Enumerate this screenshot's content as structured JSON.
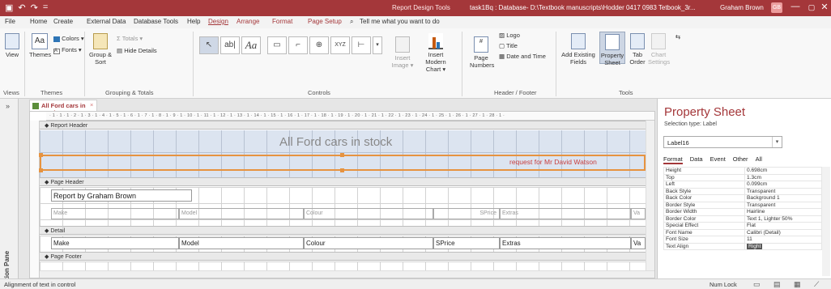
{
  "titlebar": {
    "context": "Report Design Tools",
    "document": "task1Bq : Database- D:\\Textbook manuscripts\\Hodder 0417 0983 Tetbook_3r...",
    "user": "Graham Brown",
    "avatar": "GB",
    "controls": [
      "—",
      "▢",
      "✕"
    ],
    "qa_icons": [
      "save-icon",
      "undo-icon",
      "redo-icon",
      "customize-icon"
    ]
  },
  "tabs": [
    "File",
    "Home",
    "Create",
    "External Data",
    "Database Tools",
    "Help",
    "Design",
    "Arrange",
    "Format",
    "Page Setup"
  ],
  "tell_me": "Tell me what you want to do",
  "ribbon": {
    "views": {
      "view": "View",
      "group": "Views"
    },
    "themes": {
      "themes": "Themes",
      "colors": "Colors ▾",
      "fonts": "Fonts ▾",
      "group": "Themes"
    },
    "grouping": {
      "group_sort": "Group & Sort",
      "totals": "Totals ▾",
      "hide_details": "Hide Details",
      "group": "Grouping & Totals"
    },
    "controls": {
      "group": "Controls",
      "insert_image": "Insert Image ▾",
      "insert_modern_chart": "Insert Modern Chart ▾",
      "label_glyph": "Aa",
      "textbox_glyph": "ab|",
      "xyz": "XYZ"
    },
    "header_footer": {
      "page_numbers": "Page Numbers",
      "logo": "Logo",
      "title": "Title",
      "date_time": "Date and Time",
      "group": "Header / Footer"
    },
    "tools": {
      "add_existing_fields": "Add Existing Fields",
      "property_sheet": "Property Sheet",
      "tab_order": "Tab Order",
      "chart_settings": "Chart Settings",
      "group": "Tools"
    }
  },
  "navpane": {
    "label": "Navigation Pane",
    "chevron": "»"
  },
  "doc_tab": {
    "label": "All Ford cars in stock",
    "close": "×"
  },
  "designer": {
    "ruler": "· 1 · 1 · 1 · 2 · 1 · 3 · 1 · 4 · 1 · 5 · 1 · 6 · 1 · 7 · 1 · 8 · 1 · 9 · 1 · 10 · 1 · 11 · 1 · 12 · 1 · 13 · 1 · 14 · 1 · 15 · 1 · 16 · 1 · 17 · 1 · 18 · 1 · 19 · 1 · 20 · 1 · 21 · 1 · 22 · 1 · 23 · 1 · 24 · 1 · 25 · 1 · 26 · 1 · 27 · 1 · 28 · 1 ·",
    "sections": {
      "report_header": "Report Header",
      "page_header": "Page Header",
      "detail": "Detail",
      "page_footer": "Page Footer"
    },
    "report_title": "All Ford cars in stock",
    "request_label": "request for Mr David Watson",
    "report_by": "Report by Graham Brown",
    "header_labels": [
      "Make",
      "Model",
      "Colour",
      "SPrice",
      "Extras",
      "Va"
    ],
    "detail_fields": [
      "Make",
      "Model",
      "Colour",
      "SPrice",
      "Extras",
      "Va"
    ]
  },
  "property_sheet": {
    "title": "Property Sheet",
    "selection_type": "Selection type: Label",
    "selected_object": "Label16",
    "tabs": [
      "Format",
      "Data",
      "Event",
      "Other",
      "All"
    ],
    "active_tab": "Format",
    "rows": [
      {
        "k": "Height",
        "v": "0.698cm"
      },
      {
        "k": "Top",
        "v": "1.3cm"
      },
      {
        "k": "Left",
        "v": "0.099cm"
      },
      {
        "k": "Back Style",
        "v": "Transparent"
      },
      {
        "k": "Back Color",
        "v": "Background 1"
      },
      {
        "k": "Border Style",
        "v": "Transparent"
      },
      {
        "k": "Border Width",
        "v": "Hairline"
      },
      {
        "k": "Border Color",
        "v": "Text 1, Lighter 50%"
      },
      {
        "k": "Special Effect",
        "v": "Flat"
      },
      {
        "k": "Font Name",
        "v": "Calibri (Detail)"
      },
      {
        "k": "Font Size",
        "v": "11"
      },
      {
        "k": "Text Align",
        "v": "Right"
      }
    ]
  },
  "statusbar": {
    "message": "Alignment of text in control",
    "numlock": "Num Lock"
  },
  "colors": {
    "accent": "#a4373a",
    "selection": "#e69340",
    "band": "#dce4f0"
  }
}
